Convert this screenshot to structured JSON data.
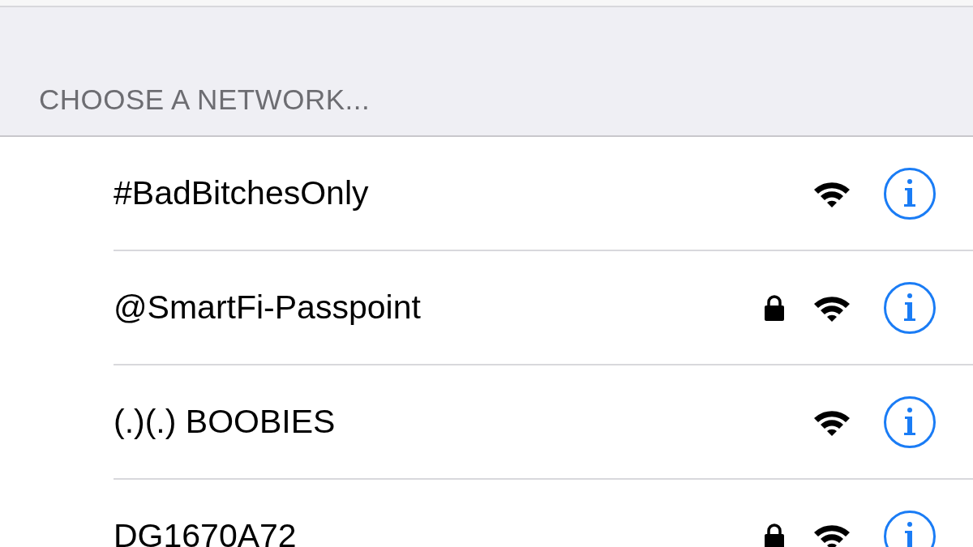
{
  "section_header": "CHOOSE A NETWORK...",
  "networks": [
    {
      "name": "#BadBitchesOnly",
      "secured": false
    },
    {
      "name": "@SmartFi-Passpoint",
      "secured": true
    },
    {
      "name": "(.)(.) BOOBIES",
      "secured": false
    },
    {
      "name": "DG1670A72",
      "secured": true
    }
  ]
}
